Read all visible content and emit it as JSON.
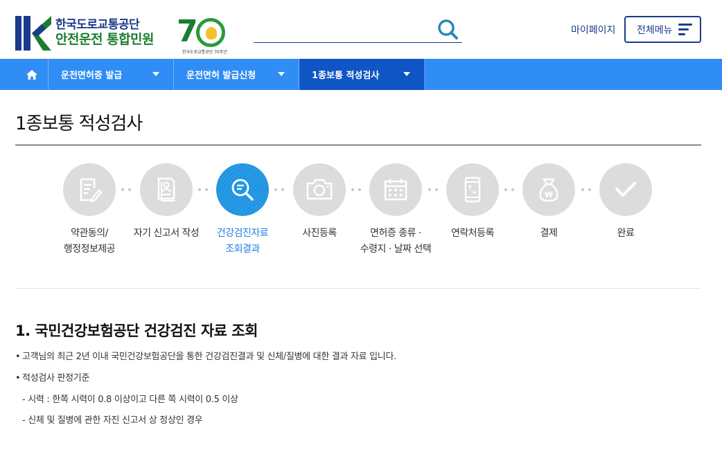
{
  "header": {
    "logo_line1": "한국도로교통공단",
    "logo_line2": "안전운전 통합민원",
    "anniversary_number": "7",
    "anniversary_caption": "한국도로교통공단 70주년",
    "search_placeholder": "",
    "mypage_label": "마이페이지",
    "allmenu_label": "전체메뉴"
  },
  "nav": {
    "items": [
      {
        "label": "운전면허증 발급"
      },
      {
        "label": "운전면허 발급신청"
      },
      {
        "label": "1종보통 적성검사"
      }
    ]
  },
  "page_title": "1종보통 적성검사",
  "steps": [
    {
      "line1": "약관동의/",
      "line2": "행정정보제공",
      "icon": "document-edit-icon"
    },
    {
      "line1": "자기 신고서 작성",
      "line2": "",
      "icon": "person-document-icon"
    },
    {
      "line1": "건강검진자료",
      "line2": "조회결과",
      "icon": "search-document-icon",
      "active": true
    },
    {
      "line1": "사진등록",
      "line2": "",
      "icon": "camera-icon"
    },
    {
      "line1": "면허증 종류 ·",
      "line2": "수령지 · 날짜 선택",
      "icon": "calendar-icon"
    },
    {
      "line1": "연락처등록",
      "line2": "",
      "icon": "phone-icon"
    },
    {
      "line1": "결제",
      "line2": "",
      "icon": "money-bag-icon"
    },
    {
      "line1": "완료",
      "line2": "",
      "icon": "check-icon"
    }
  ],
  "section": {
    "title": "1. 국민건강보험공단 건강검진 자료 조회",
    "bullet1": "고객님의 최근 2년 이내 국민건강보험공단을 통한 건강검진결과 및 신체/질병에 대한 결과 자료 입니다.",
    "bullet2": "적성검사 판정기준",
    "sub1": "- 시력 : 한쪽 시력이 0.8 이상이고 다른 쪽 시력이 0.5 이상",
    "sub2": "- 신체 및 질병에 관한 자진 신고서 상 정상인 경우"
  },
  "colors": {
    "nav_bg": "#2f8df5",
    "nav_active": "#0f55c6",
    "brand_blue": "#1b3a8c",
    "brand_green": "#1b7d2f",
    "step_active": "#2a9fe8",
    "step_inactive": "#dcdcdc"
  }
}
